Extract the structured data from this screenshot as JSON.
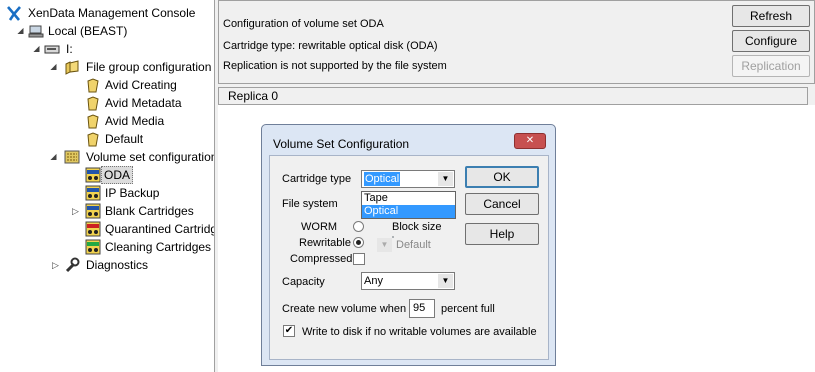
{
  "tree": {
    "items": [
      {
        "name": "tree-root-xendata",
        "label": "XenData Management Console",
        "icon": "xendata-logo-icon",
        "level": 0
      },
      {
        "name": "tree-item-local",
        "label": "Local (BEAST)",
        "icon": "computer-icon",
        "level": 1
      },
      {
        "name": "tree-item-drive-i",
        "label": "I:",
        "icon": "drive-icon",
        "level": 2
      },
      {
        "name": "tree-item-file-group-configuration",
        "label": "File group configuration",
        "icon": "folder-group-icon",
        "level": 3
      },
      {
        "name": "tree-item-avid-creating",
        "label": "Avid Creating",
        "icon": "folder-icon",
        "level": 4
      },
      {
        "name": "tree-item-avid-metadata",
        "label": "Avid Metadata",
        "icon": "folder-icon",
        "level": 4
      },
      {
        "name": "tree-item-avid-media",
        "label": "Avid Media",
        "icon": "folder-icon",
        "level": 4
      },
      {
        "name": "tree-item-default",
        "label": "Default",
        "icon": "folder-icon",
        "level": 4
      },
      {
        "name": "tree-item-volume-set-configuration",
        "label": "Volume set configuration",
        "icon": "volume-set-icon",
        "level": 3
      },
      {
        "name": "tree-item-oda",
        "label": "ODA",
        "icon": "cartridge-icon",
        "level": 4,
        "selected": true
      },
      {
        "name": "tree-item-ip-backup",
        "label": "IP Backup",
        "icon": "cartridge-icon",
        "level": 4
      },
      {
        "name": "tree-item-blank-cartridges",
        "label": "Blank Cartridges",
        "icon": "cartridge-icon",
        "level": 4
      },
      {
        "name": "tree-item-quarantined-cartridges",
        "label": "Quarantined Cartridges",
        "icon": "quarantined-cartridge-icon",
        "level": 4
      },
      {
        "name": "tree-item-cleaning-cartridges",
        "label": "Cleaning Cartridges",
        "icon": "cleaning-cartridge-icon",
        "level": 4
      },
      {
        "name": "tree-item-diagnostics",
        "label": "Diagnostics",
        "icon": "wrench-icon",
        "level": 3
      }
    ]
  },
  "info": {
    "line1": "Configuration of volume set ODA",
    "line2": "Cartridge type: rewritable optical disk (ODA)",
    "line3": "Replication is not supported by the file system",
    "refresh": "Refresh",
    "configure": "Configure",
    "replication": "Replication"
  },
  "replica_tab": "Replica 0",
  "dialog": {
    "title": "Volume Set Configuration",
    "close_symbol": "✕",
    "cartridge_type_label": "Cartridge type",
    "cartridge_type_value": "Optical",
    "cartridge_type_options": [
      "Tape",
      "Optical"
    ],
    "file_system_label": "File system",
    "worm_label": "WORM",
    "rewritable_label": "Rewritable",
    "compressed_label": "Compressed",
    "block_size_label": "Block size",
    "block_size_value": "Default",
    "capacity_label": "Capacity",
    "capacity_value": "Any",
    "create_new_label": "Create new volume when",
    "percent_value": "95",
    "percent_full_label": "percent full",
    "write_to_disk_label": "Write to disk if no writable volumes are available",
    "write_to_disk_checked": true,
    "ok": "OK",
    "cancel": "Cancel",
    "help": "Help"
  },
  "colors": {
    "selection": "#3399ff",
    "dialog_frame": "#dce6f4",
    "close_button": "#c75050"
  }
}
